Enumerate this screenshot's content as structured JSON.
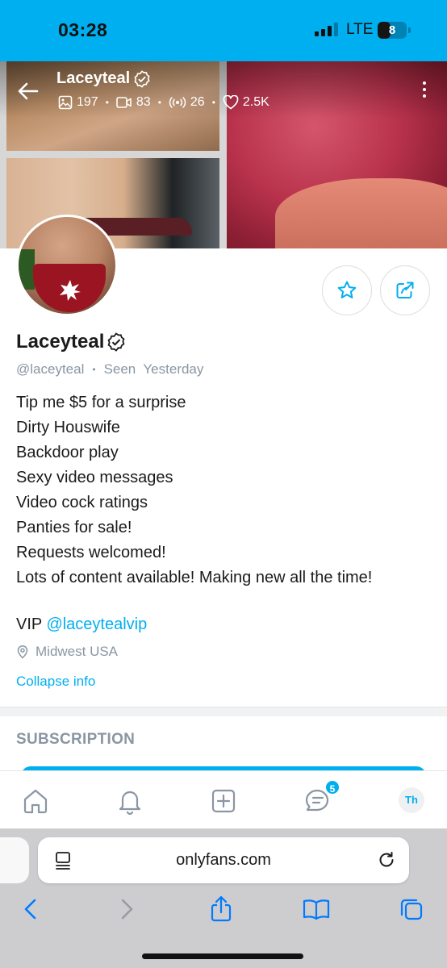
{
  "status_bar": {
    "time": "03:28",
    "network": "LTE",
    "battery": "8",
    "battery_level": 0.08,
    "background_color": "#00aff0"
  },
  "header": {
    "name": "Laceyteal",
    "stats": {
      "photos": "197",
      "videos": "83",
      "streams": "26",
      "likes": "2.5K"
    },
    "icons": [
      "back-arrow-icon",
      "image-icon",
      "video-icon",
      "stream-icon",
      "heart-icon",
      "more-vertical-icon"
    ]
  },
  "profile": {
    "name": "Laceyteal",
    "handle": "@laceyteal",
    "separator": "•",
    "last_seen": "Seen  Yesterday",
    "bio_lines": [
      "Tip me $5 for a surprise",
      "Dirty Houswife",
      "Backdoor play",
      "Sexy video messages",
      "Video cock ratings",
      "Panties for sale!",
      "Requests welcomed!",
      "Lots of content available! Making new all the time!"
    ],
    "vip_prefix": "VIP ",
    "vip_handle": "@laceytealvip",
    "location": "Midwest USA",
    "collapse_label": "Collapse info"
  },
  "subscription": {
    "title": "SUBSCRIPTION"
  },
  "bottom_nav": {
    "items": [
      "home-icon",
      "bell-icon",
      "add-post-icon",
      "messages-icon"
    ],
    "messages_badge": "5",
    "avatar_initials": "Th"
  },
  "browser": {
    "url": "onlyfans.com"
  },
  "colors": {
    "accent": "#00aff0",
    "muted_text": "#8a96a3",
    "primary_text": "#1b1b1b",
    "ios_tint": "#007aff"
  }
}
